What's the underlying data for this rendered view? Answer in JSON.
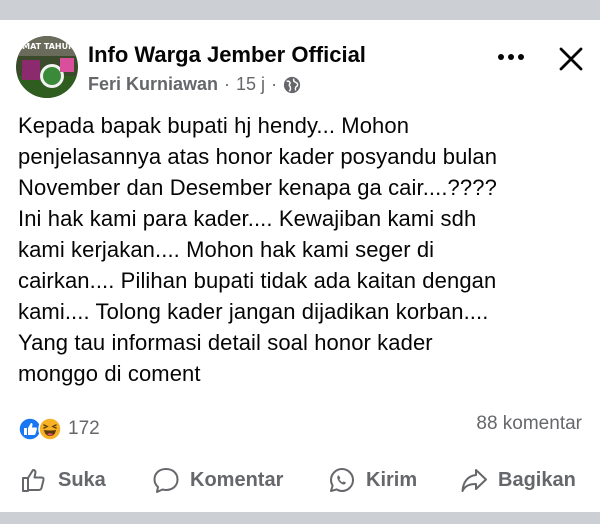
{
  "post": {
    "group_name": "Info Warga Jember Official",
    "author": "Feri Kurniawan",
    "time": "15 j",
    "separator": "·",
    "body": "Kepada bapak bupati hj hendy... Mohon\npenjelasannya atas honor kader posyandu bulan\nNovember dan Desember kenapa ga cair....????\nIni hak kami para kader.... Kewajiban kami sdh\nkami kerjakan.... Mohon hak kami seger di\ncairkan.... Pilihan bupati tidak ada kaitan dengan\nkami.... Tolong kader jangan dijadikan korban....\nYang tau informasi detail soal honor kader\nmonggo di coment",
    "reaction_count": "172",
    "comment_count": "88 komentar"
  },
  "actions": {
    "like": "Suka",
    "comment": "Komentar",
    "send": "Kirim",
    "share": "Bagikan"
  },
  "avatar_text": "IMAT TAHUN",
  "icons": {
    "like_reaction": "like-reaction-icon",
    "haha_reaction": "haha-reaction-icon",
    "privacy": "globe-icon"
  },
  "colors": {
    "like_blue": "#1877f2",
    "haha_yellow": "#f7b125",
    "muted": "#65676b",
    "divider": "#ccd0d5"
  }
}
